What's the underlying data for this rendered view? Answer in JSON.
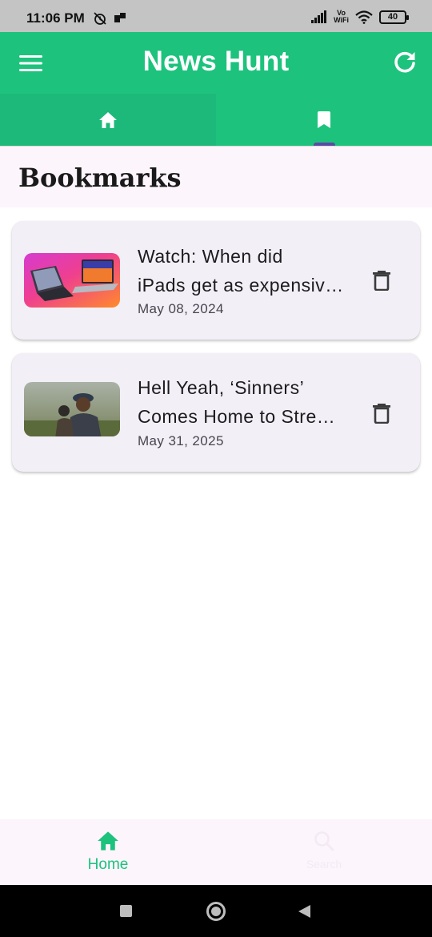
{
  "status_bar": {
    "time": "11:06 PM",
    "battery": "40",
    "vowifi_top": "Vo",
    "vowifi_bottom": "WiFi",
    "icons": [
      "alarm-off-icon",
      "app-notification-icon",
      "signal-icon",
      "wifi-icon",
      "battery-icon"
    ]
  },
  "app_bar": {
    "title": "News Hunt",
    "menu_icon": "menu-icon",
    "refresh_icon": "refresh-icon",
    "background": "#1dc27d"
  },
  "tabs": [
    {
      "icon": "home-icon",
      "selected": false
    },
    {
      "icon": "bookmark-icon",
      "selected": true
    }
  ],
  "section": {
    "title": "Bookmarks"
  },
  "bookmarks": [
    {
      "title_line1": "Watch: When did",
      "title_line2": "iPads get as expensive as MacBooks?",
      "date": "May 08, 2024",
      "thumbnail": "ipad-macbook-image",
      "delete_icon": "delete-icon"
    },
    {
      "title_line1": "Hell Yeah, ‘Sinners’",
      "title_line2": "Comes Home to Streaming",
      "date": "May 31, 2025",
      "thumbnail": "sinners-movie-still-image",
      "delete_icon": "delete-icon"
    }
  ],
  "bottom_nav": {
    "items": [
      {
        "label": "Home",
        "icon": "home-icon",
        "selected": true
      },
      {
        "label": "Search",
        "icon": "search-icon",
        "selected": false
      }
    ],
    "accent": "#1dc27d"
  },
  "system_nav": {
    "icons": [
      "recents-icon",
      "home-circle-icon",
      "back-icon"
    ]
  }
}
